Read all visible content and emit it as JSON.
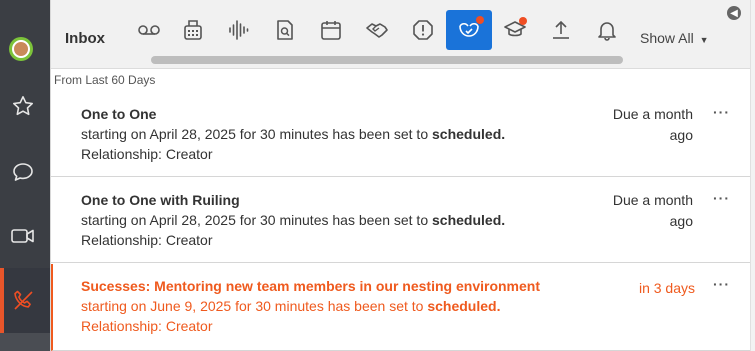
{
  "sidebar": {
    "avatar": "user-avatar",
    "items": [
      {
        "name": "favorites",
        "icon": "star-icon"
      },
      {
        "name": "chat",
        "icon": "chat-bubble-icon"
      },
      {
        "name": "video",
        "icon": "video-camera-icon"
      },
      {
        "name": "calls",
        "icon": "phone-off-icon"
      }
    ],
    "accent": "#e8552a"
  },
  "header": {
    "title": "Inbox",
    "filter_label": "Show All",
    "toolbar": [
      {
        "icon": "voicemail-icon"
      },
      {
        "icon": "fax-icon"
      },
      {
        "icon": "audio-waveform-icon"
      },
      {
        "icon": "document-search-icon"
      },
      {
        "icon": "calendar-icon"
      },
      {
        "icon": "handshake-icon"
      },
      {
        "icon": "alert-icon"
      },
      {
        "icon": "mentoring-icon",
        "active": true,
        "badge": true
      },
      {
        "icon": "graduation-cap-icon",
        "badge": true
      },
      {
        "icon": "upload-icon"
      },
      {
        "icon": "bell-icon"
      }
    ],
    "active_color": "#1a73d9",
    "badge_color": "#ef4e23"
  },
  "list": {
    "range_label": "From Last 60 Days",
    "items": [
      {
        "title": "One to One",
        "line_prefix": "starting on April 28, 2025 for 30 minutes has been set to ",
        "status": "scheduled.",
        "relationship": "Relationship: Creator",
        "due": "Due a month ago",
        "more": "···"
      },
      {
        "title": "One to One with Ruiling",
        "line_prefix": "starting on April 28, 2025 for 30 minutes has been set to ",
        "status": "scheduled.",
        "relationship": "Relationship: Creator",
        "due": "Due a month ago",
        "more": "···"
      },
      {
        "title": "Sucesses: Mentoring new team members in our nesting environment",
        "line_prefix": "starting on June 9, 2025 for 30 minutes has been set to ",
        "status": "scheduled.",
        "relationship": "Relationship: Creator",
        "due": "in 3 days",
        "more": "···",
        "highlight_color": "#ef5a1e"
      }
    ]
  }
}
